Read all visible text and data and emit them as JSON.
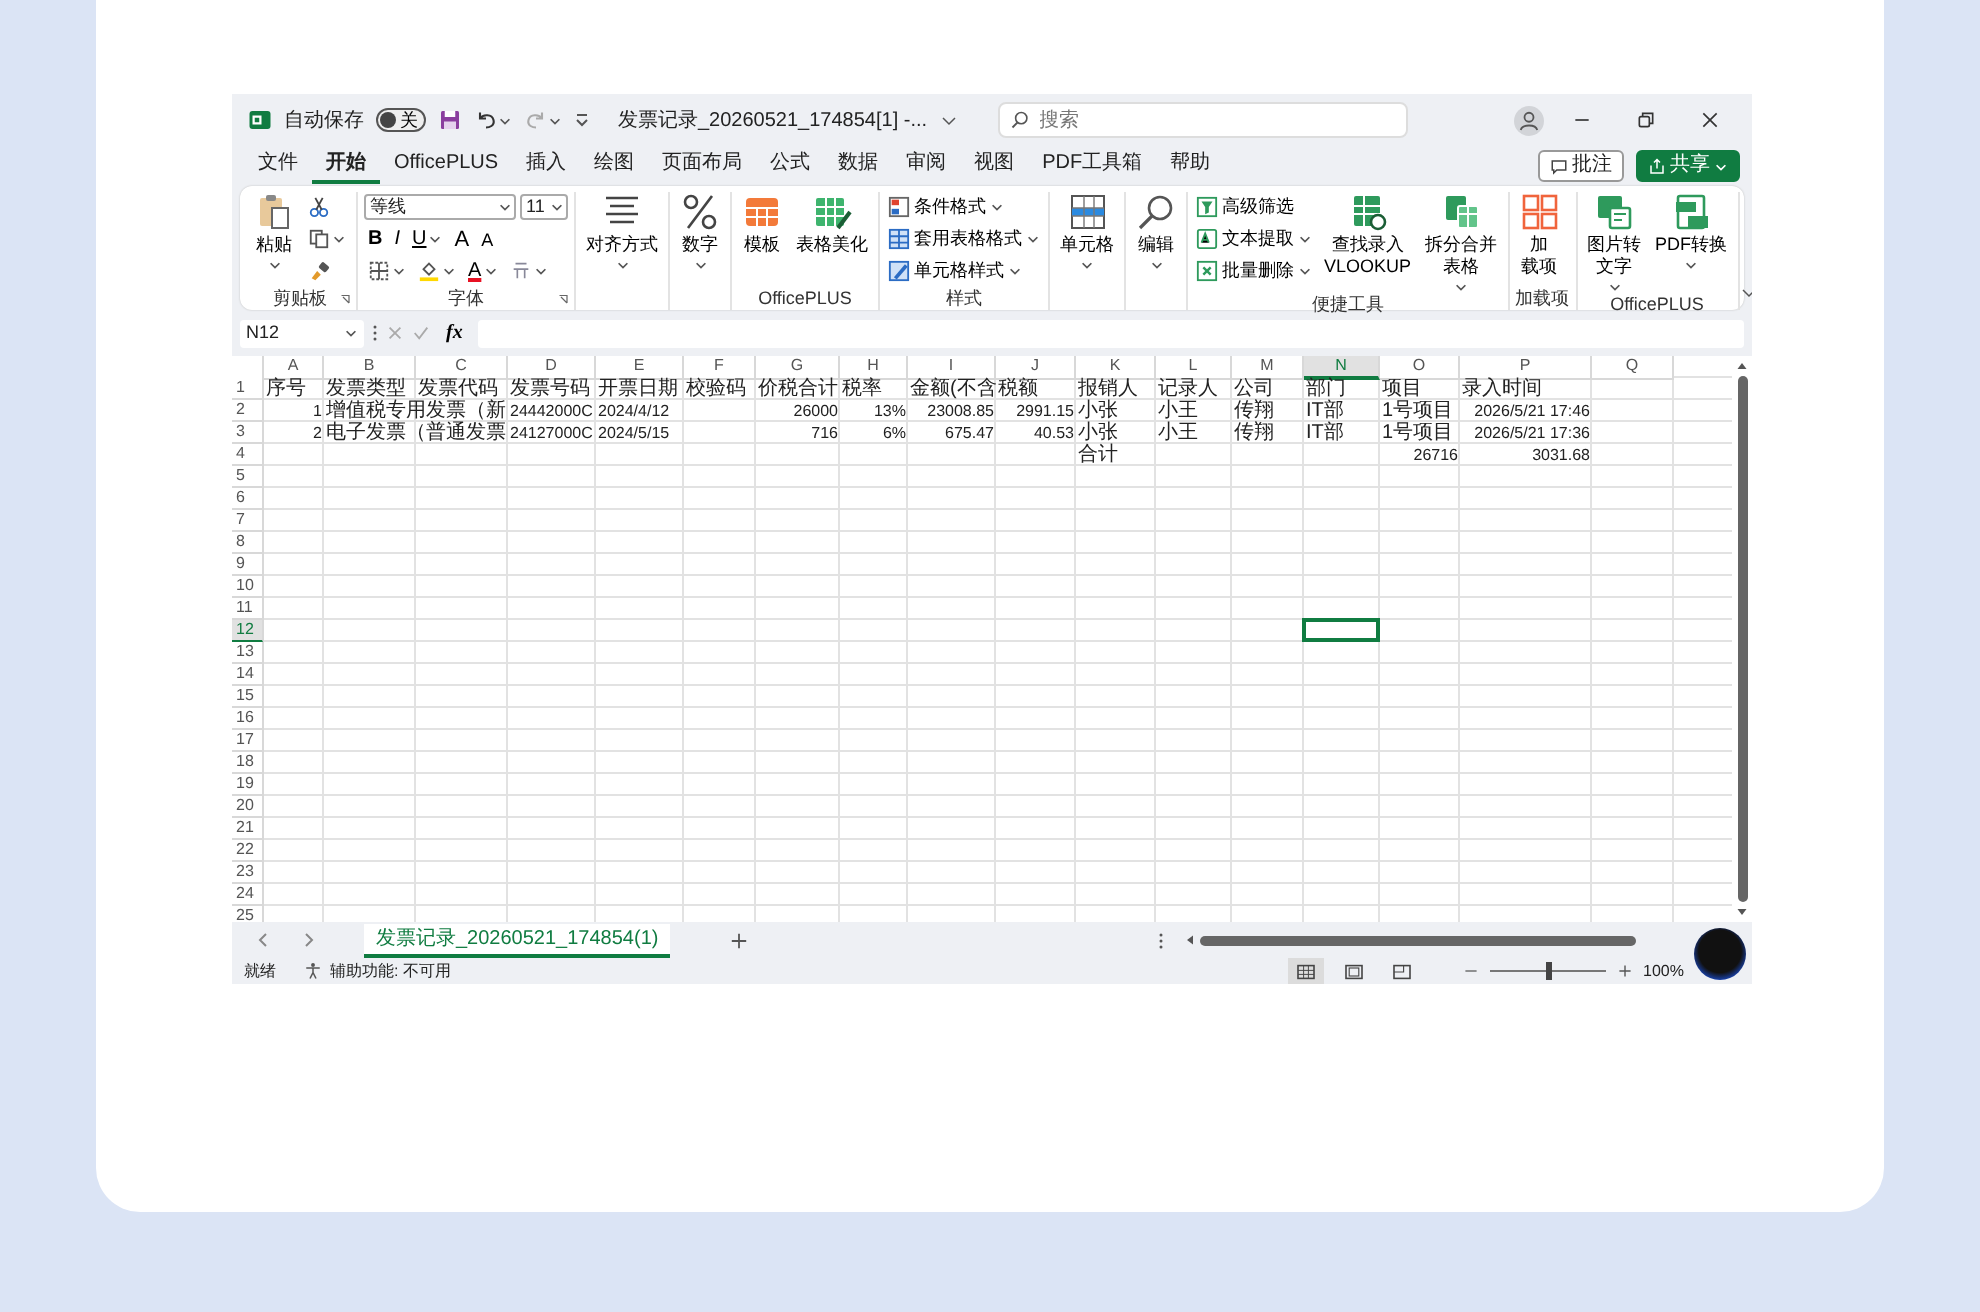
{
  "window": {
    "title": "发票记录_20260521_174854[1]  -...",
    "autosave_label": "自动保存",
    "autosave_toggle": {
      "label": "关",
      "on": false
    }
  },
  "search": {
    "placeholder": "搜索"
  },
  "menu_tabs": [
    {
      "label": "文件",
      "selected": false
    },
    {
      "label": "开始",
      "selected": true
    },
    {
      "label": "OfficePLUS",
      "selected": false
    },
    {
      "label": "插入",
      "selected": false
    },
    {
      "label": "绘图",
      "selected": false
    },
    {
      "label": "页面布局",
      "selected": false
    },
    {
      "label": "公式",
      "selected": false
    },
    {
      "label": "数据",
      "selected": false
    },
    {
      "label": "审阅",
      "selected": false
    },
    {
      "label": "视图",
      "selected": false
    },
    {
      "label": "PDF工具箱",
      "selected": false
    },
    {
      "label": "帮助",
      "selected": false
    }
  ],
  "header_buttons": [
    {
      "label": "批注",
      "kind": "outline"
    },
    {
      "label": "共享",
      "kind": "primary"
    }
  ],
  "ribbon": [
    {
      "label": "剪贴板",
      "launcher": true,
      "columns": [
        [
          [
            {
              "kind": "large",
              "lines": [
                "粘贴"
              ],
              "dropdown": true
            }
          ]
        ],
        [
          [
            {
              "kind": "icon",
              "dropdown": false
            }
          ],
          [
            {
              "kind": "icon",
              "dropdown": true
            }
          ],
          [
            {
              "kind": "icon",
              "dropdown": false
            }
          ]
        ]
      ]
    },
    {
      "label": "字体",
      "launcher": true,
      "columns": [
        [
          [
            {
              "kind": "select",
              "value": "等线"
            },
            {
              "kind": "select",
              "value": "11"
            }
          ],
          [
            {
              "kind": "bold",
              "label": "B"
            },
            {
              "kind": "italic",
              "label": "I"
            },
            {
              "kind": "underline",
              "label": "U",
              "dropdown": true
            },
            {
              "kind": "grow",
              "label": "A"
            },
            {
              "kind": "shrink",
              "label": "A"
            }
          ],
          [
            {
              "kind": "icon",
              "dropdown": true
            },
            {
              "kind": "icon",
              "dropdown": true
            },
            {
              "kind": "color",
              "label": "A",
              "dropdown": true
            },
            {
              "kind": "icon",
              "dropdown": true
            }
          ]
        ]
      ]
    },
    {
      "launcher": false,
      "columns": [
        [
          [
            {
              "kind": "large",
              "lines": [
                "对齐方式"
              ],
              "dropdown": true
            }
          ]
        ]
      ]
    },
    {
      "launcher": false,
      "columns": [
        [
          [
            {
              "kind": "large",
              "lines": [
                "数字"
              ],
              "dropdown": true
            }
          ]
        ]
      ]
    },
    {
      "label": "OfficePLUS",
      "launcher": false,
      "columns": [
        [
          [
            {
              "kind": "large",
              "lines": [
                "模板"
              ],
              "dropdown": false
            }
          ]
        ],
        [
          [
            {
              "kind": "large",
              "lines": [
                "表格美化"
              ],
              "dropdown": false
            }
          ]
        ]
      ]
    },
    {
      "label": "样式",
      "launcher": false,
      "columns": [
        [
          [
            {
              "kind": "small",
              "label": "条件格式",
              "dropdown": true
            }
          ],
          [
            {
              "kind": "small",
              "label": "套用表格格式",
              "dropdown": true
            }
          ],
          [
            {
              "kind": "small",
              "label": "单元格样式",
              "dropdown": true
            }
          ]
        ]
      ]
    },
    {
      "launcher": false,
      "columns": [
        [
          [
            {
              "kind": "large",
              "lines": [
                "单元格"
              ],
              "dropdown": true
            }
          ]
        ]
      ]
    },
    {
      "launcher": false,
      "columns": [
        [
          [
            {
              "kind": "large",
              "lines": [
                "编辑"
              ],
              "dropdown": true
            }
          ]
        ]
      ]
    },
    {
      "label": "便捷工具",
      "launcher": false,
      "columns": [
        [
          [
            {
              "kind": "small",
              "label": "高级筛选",
              "dropdown": false
            }
          ],
          [
            {
              "kind": "small",
              "label": "文本提取",
              "dropdown": true
            }
          ],
          [
            {
              "kind": "small",
              "label": "批量删除",
              "dropdown": true
            }
          ]
        ],
        [
          [
            {
              "kind": "large",
              "lines": [
                "查找录入",
                "VLOOKUP"
              ],
              "dropdown": false
            }
          ]
        ],
        [
          [
            {
              "kind": "large",
              "lines": [
                "拆分合并",
                "表格"
              ],
              "dropdown": true
            }
          ]
        ]
      ]
    },
    {
      "label": "加载项",
      "launcher": false,
      "columns": [
        [
          [
            {
              "kind": "large",
              "lines": [
                "加",
                "载项"
              ],
              "dropdown": false
            }
          ]
        ]
      ]
    },
    {
      "label": "OfficePLUS",
      "launcher": false,
      "columns": [
        [
          [
            {
              "kind": "large",
              "lines": [
                "图片转",
                "文字"
              ],
              "dropdown": true
            }
          ]
        ],
        [
          [
            {
              "kind": "large",
              "lines": [
                "PDF转换"
              ],
              "dropdown": true
            }
          ]
        ]
      ]
    }
  ],
  "formula_bar": {
    "name_box": "N12",
    "fx": "fx"
  },
  "columns": [
    {
      "label": "A",
      "selected": false
    },
    {
      "label": "B",
      "selected": false
    },
    {
      "label": "C",
      "selected": false
    },
    {
      "label": "D",
      "selected": false
    },
    {
      "label": "E",
      "selected": false
    },
    {
      "label": "F",
      "selected": false
    },
    {
      "label": "G",
      "selected": false
    },
    {
      "label": "H",
      "selected": false
    },
    {
      "label": "I",
      "selected": false
    },
    {
      "label": "J",
      "selected": false
    },
    {
      "label": "K",
      "selected": false
    },
    {
      "label": "L",
      "selected": false
    },
    {
      "label": "M",
      "selected": false
    },
    {
      "label": "N",
      "selected": true
    },
    {
      "label": "O",
      "selected": false
    },
    {
      "label": "P",
      "selected": false
    },
    {
      "label": "Q",
      "selected": false
    }
  ],
  "rows": [
    {
      "label": "1",
      "selected": false,
      "cells": [
        {
          "text": "序号",
          "kind": "text"
        },
        {
          "text": "发票类型",
          "kind": "text"
        },
        {
          "text": "发票代码",
          "kind": "text"
        },
        {
          "text": "发票号码",
          "kind": "text"
        },
        {
          "text": "开票日期",
          "kind": "text"
        },
        {
          "text": "校验码",
          "kind": "text"
        },
        {
          "text": "价税合计",
          "kind": "text"
        },
        {
          "text": "税率",
          "kind": "text"
        },
        {
          "text": "金额(不含",
          "kind": "text"
        },
        {
          "text": "税额",
          "kind": "text"
        },
        {
          "text": "报销人",
          "kind": "text"
        },
        {
          "text": "记录人",
          "kind": "text"
        },
        {
          "text": "公司",
          "kind": "text"
        },
        {
          "text": "部门",
          "kind": "text"
        },
        {
          "text": "项目",
          "kind": "text"
        },
        {
          "text": "录入时间",
          "kind": "text"
        },
        null
      ]
    },
    {
      "label": "2",
      "selected": false,
      "cells": [
        {
          "text": "1",
          "kind": "number"
        },
        {
          "text": "增值税专用发票（新",
          "kind": "text"
        },
        null,
        {
          "text": "24442000C",
          "kind": "text"
        },
        {
          "text": "2024/4/12",
          "kind": "text"
        },
        null,
        {
          "text": "26000",
          "kind": "number"
        },
        {
          "text": "13%",
          "kind": "number"
        },
        {
          "text": "23008.85",
          "kind": "number"
        },
        {
          "text": "2991.15",
          "kind": "number"
        },
        {
          "text": "小张",
          "kind": "text"
        },
        {
          "text": "小王",
          "kind": "text"
        },
        {
          "text": "传翔",
          "kind": "text"
        },
        {
          "text": "IT部",
          "kind": "text"
        },
        {
          "text": "1号项目",
          "kind": "text"
        },
        {
          "text": "2026/5/21 17:46",
          "kind": "number"
        },
        null
      ]
    },
    {
      "label": "3",
      "selected": false,
      "cells": [
        {
          "text": "2",
          "kind": "number"
        },
        {
          "text": "电子发票（普通发票",
          "kind": "text"
        },
        null,
        {
          "text": "24127000C",
          "kind": "text"
        },
        {
          "text": "2024/5/15",
          "kind": "text"
        },
        null,
        {
          "text": "716",
          "kind": "number"
        },
        {
          "text": "6%",
          "kind": "number"
        },
        {
          "text": "675.47",
          "kind": "number"
        },
        {
          "text": "40.53",
          "kind": "number"
        },
        {
          "text": "小张",
          "kind": "text"
        },
        {
          "text": "小王",
          "kind": "text"
        },
        {
          "text": "传翔",
          "kind": "text"
        },
        {
          "text": "IT部",
          "kind": "text"
        },
        {
          "text": "1号项目",
          "kind": "text"
        },
        {
          "text": "2026/5/21 17:36",
          "kind": "number"
        },
        null
      ]
    },
    {
      "label": "4",
      "selected": false,
      "cells": [
        null,
        null,
        null,
        null,
        null,
        null,
        null,
        null,
        null,
        null,
        {
          "text": "合计",
          "kind": "text"
        },
        null,
        null,
        null,
        {
          "text": "26716",
          "kind": "number"
        },
        {
          "text": "3031.68",
          "kind": "number"
        },
        null
      ]
    },
    {
      "label": "5",
      "selected": false
    },
    {
      "label": "6",
      "selected": false
    },
    {
      "label": "7",
      "selected": false
    },
    {
      "label": "8",
      "selected": false
    },
    {
      "label": "9",
      "selected": false
    },
    {
      "label": "10",
      "selected": false
    },
    {
      "label": "11",
      "selected": false
    },
    {
      "label": "12",
      "selected": true
    },
    {
      "label": "13",
      "selected": false
    },
    {
      "label": "14",
      "selected": false
    },
    {
      "label": "15",
      "selected": false
    },
    {
      "label": "16",
      "selected": false
    },
    {
      "label": "17",
      "selected": false
    },
    {
      "label": "18",
      "selected": false
    },
    {
      "label": "19",
      "selected": false
    },
    {
      "label": "20",
      "selected": false
    },
    {
      "label": "21",
      "selected": false
    },
    {
      "label": "22",
      "selected": false
    },
    {
      "label": "23",
      "selected": false
    },
    {
      "label": "24",
      "selected": false
    },
    {
      "label": "25",
      "selected": false
    }
  ],
  "sheet_tabs": [
    {
      "label": "发票记录_20260521_174854(1)",
      "selected": true
    }
  ],
  "status_bar": {
    "ready": "就绪",
    "accessibility": "辅助功能: 不可用",
    "views": [
      {
        "selected": true
      },
      {
        "selected": false
      },
      {
        "selected": false
      }
    ],
    "zoom": {
      "level": 0.5,
      "label": "100%"
    }
  }
}
